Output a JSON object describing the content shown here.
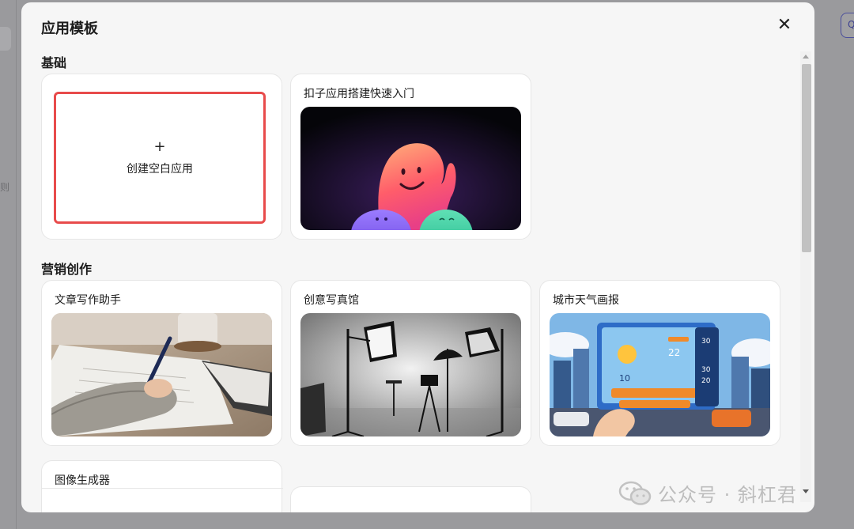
{
  "background": {
    "left_fragment": "则",
    "right_button_glyph": "Q"
  },
  "modal": {
    "title": "应用模板",
    "close_glyph": "✕"
  },
  "sections": [
    {
      "title": "基础",
      "cards": [
        {
          "type": "blank",
          "plus": "+",
          "label": "创建空白应用"
        },
        {
          "type": "template",
          "title": "扣子应用搭建快速入门",
          "thumb": "mascot-illustration"
        }
      ]
    },
    {
      "title": "营销创作",
      "cards": [
        {
          "type": "template",
          "title": "文章写作助手",
          "thumb": "writing-photo"
        },
        {
          "type": "template",
          "title": "创意写真馆",
          "thumb": "photo-studio-photo"
        },
        {
          "type": "template",
          "title": "城市天气画报",
          "thumb": "city-weather-illustration"
        }
      ]
    },
    {
      "cards": [
        {
          "type": "template",
          "title": "图像生成器",
          "thumb": ""
        }
      ]
    }
  ],
  "weather_thumb_text": {
    "temp_top": "30",
    "temp_mid": "22",
    "temp_low": "10",
    "temp_a": "30",
    "temp_b": "20"
  },
  "watermark": {
    "text": "公众号 · 斜杠君"
  },
  "colors": {
    "accent_red": "#e84b4b",
    "modal_bg": "#f6f6f6",
    "overlay": "#9a9a9d"
  }
}
